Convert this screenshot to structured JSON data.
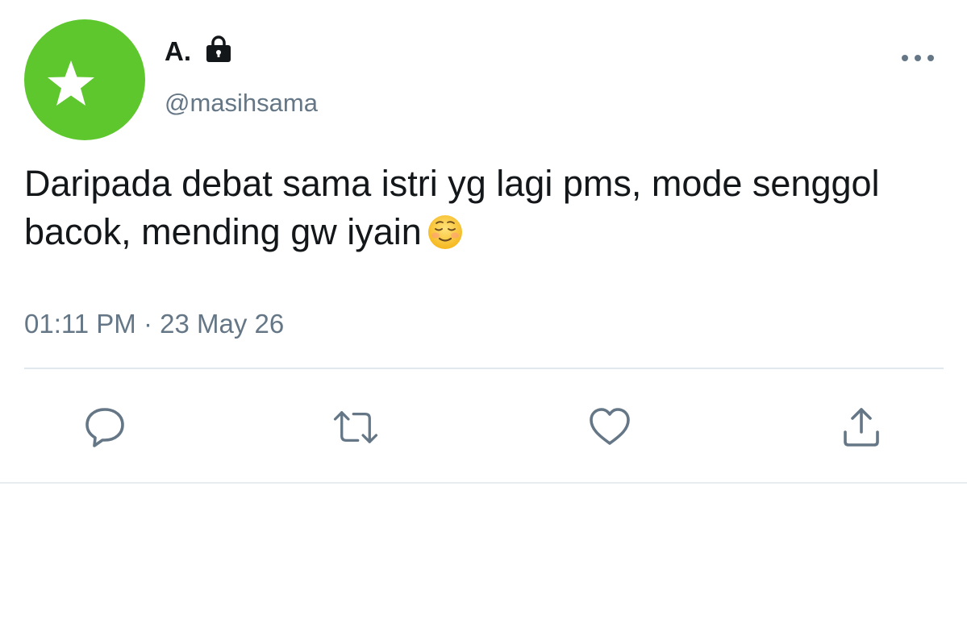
{
  "tweet": {
    "author": {
      "display_name": "A.",
      "handle": "@masihsama",
      "avatar_color": "#5ec72e",
      "avatar_icon": "star-icon",
      "protected_icon": "lock-icon"
    },
    "text": "Daripada debat sama istri yg lagi pms, mode senggol bacok, mending gw iyain",
    "emoji": "smiling-face-icon",
    "timestamp": "01:11 PM · 23 May 26",
    "actions": [
      {
        "name": "reply",
        "icon": "reply-icon"
      },
      {
        "name": "retweet",
        "icon": "retweet-icon"
      },
      {
        "name": "like",
        "icon": "heart-icon"
      },
      {
        "name": "share",
        "icon": "share-icon"
      }
    ],
    "more_icon": "more-icon"
  },
  "colors": {
    "text_primary": "#14171a",
    "text_secondary": "#657786",
    "icon": "#657786",
    "divider": "#e1e8ed"
  }
}
